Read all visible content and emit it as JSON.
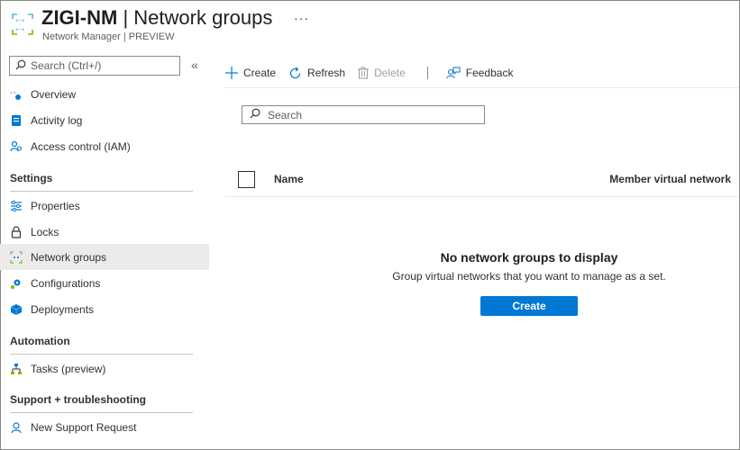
{
  "header": {
    "resource_name": "ZIGI-NM",
    "separator": " | ",
    "page_name": "Network groups",
    "subtitle": "Network Manager | PREVIEW",
    "more_label": "···"
  },
  "sidebar": {
    "search_placeholder": "Search (Ctrl+/)",
    "collapse_label": "«",
    "items_top": [
      {
        "label": "Overview",
        "icon": "overview-icon"
      },
      {
        "label": "Activity log",
        "icon": "activity-log-icon"
      },
      {
        "label": "Access control (IAM)",
        "icon": "access-control-icon"
      }
    ],
    "sections": [
      {
        "title": "Settings",
        "items": [
          {
            "label": "Properties",
            "icon": "properties-icon"
          },
          {
            "label": "Locks",
            "icon": "lock-icon"
          },
          {
            "label": "Network groups",
            "icon": "network-groups-icon",
            "active": true
          },
          {
            "label": "Configurations",
            "icon": "configurations-icon"
          },
          {
            "label": "Deployments",
            "icon": "deployments-icon"
          }
        ]
      },
      {
        "title": "Automation",
        "items": [
          {
            "label": "Tasks (preview)",
            "icon": "tasks-icon"
          }
        ]
      },
      {
        "title": "Support + troubleshooting",
        "items": [
          {
            "label": "New Support Request",
            "icon": "support-icon"
          }
        ]
      }
    ]
  },
  "toolbar": {
    "create_label": "Create",
    "refresh_label": "Refresh",
    "delete_label": "Delete",
    "feedback_label": "Feedback"
  },
  "main": {
    "search_placeholder": "Search",
    "columns": [
      "Name",
      "Member virtual network"
    ],
    "empty_title": "No network groups to display",
    "empty_description": "Group virtual networks that you want to manage as a set.",
    "create_button_label": "Create"
  },
  "colors": {
    "accent": "#0078d4",
    "active_nav": "#edebe9",
    "text": "#323130"
  }
}
